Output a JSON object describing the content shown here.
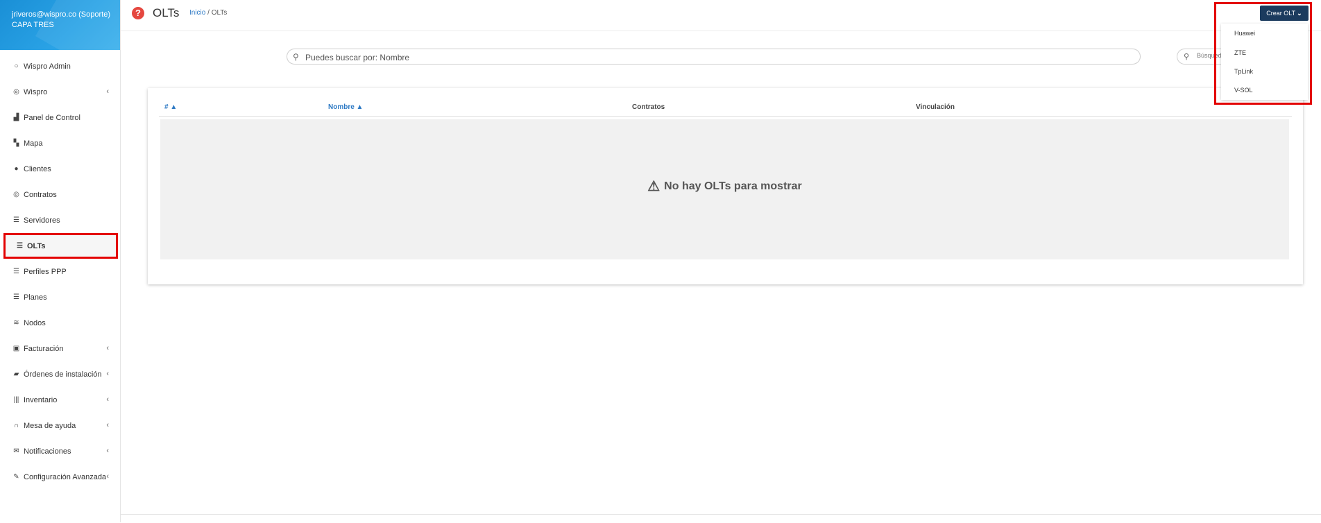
{
  "sidebar": {
    "user": {
      "email": "jriveros@wispro.co (Soporte)",
      "company": "CAPA TRES"
    },
    "items": [
      {
        "label": "Wispro Admin",
        "icon": "circle-notch-icon",
        "glyph": "○",
        "chevron": ""
      },
      {
        "label": "Wispro",
        "icon": "eye-icon",
        "glyph": "◎",
        "chevron": "‹"
      },
      {
        "label": "Panel de Control",
        "icon": "chart-area-icon",
        "glyph": "▟",
        "chevron": ""
      },
      {
        "label": "Mapa",
        "icon": "map-icon",
        "glyph": "▚",
        "chevron": ""
      },
      {
        "label": "Clientes",
        "icon": "users-icon",
        "glyph": "●",
        "chevron": ""
      },
      {
        "label": "Contratos",
        "icon": "handshake-icon",
        "glyph": "◎",
        "chevron": ""
      },
      {
        "label": "Servidores",
        "icon": "list-icon",
        "glyph": "☰",
        "chevron": ""
      },
      {
        "label": "OLTs",
        "icon": "list-icon",
        "glyph": "☰",
        "chevron": ""
      },
      {
        "label": "Perfiles PPP",
        "icon": "list-icon",
        "glyph": "☰",
        "chevron": ""
      },
      {
        "label": "Planes",
        "icon": "list-icon",
        "glyph": "☰",
        "chevron": ""
      },
      {
        "label": "Nodos",
        "icon": "wifi-icon",
        "glyph": "≋",
        "chevron": ""
      },
      {
        "label": "Facturación",
        "icon": "money-bill-icon",
        "glyph": "▣",
        "chevron": "‹"
      },
      {
        "label": "Órdenes de instalación",
        "icon": "truck-icon",
        "glyph": "▰",
        "chevron": "‹"
      },
      {
        "label": "Inventario",
        "icon": "barcode-icon",
        "glyph": "|||",
        "chevron": "‹"
      },
      {
        "label": "Mesa de ayuda",
        "icon": "headset-icon",
        "glyph": "∩",
        "chevron": "‹"
      },
      {
        "label": "Notificaciones",
        "icon": "envelope-icon",
        "glyph": "✉",
        "chevron": "‹"
      },
      {
        "label": "Configuración Avanzada",
        "icon": "wrench-icon",
        "glyph": "✎",
        "chevron": "‹"
      }
    ]
  },
  "header": {
    "title": "OLTs",
    "breadcrumb": {
      "home": "Inicio",
      "separator": "/",
      "current": "OLTs"
    },
    "help_glyph": "?"
  },
  "search": {
    "placeholder": "Puedes buscar por: Nombre",
    "value": "",
    "advanced_placeholder": "Búsqued"
  },
  "table": {
    "columns": [
      {
        "label": "# ▲",
        "sortable": true
      },
      {
        "label": "Nombre ▲",
        "sortable": true
      },
      {
        "label": "Contratos",
        "sortable": false
      },
      {
        "label": "Vinculación",
        "sortable": false
      }
    ],
    "empty_message": "No hay OLTs para mostrar"
  },
  "create_olt": {
    "label": "Crear OLT",
    "options": [
      "Huawei",
      "ZTE",
      "TpLink",
      "V-SOL"
    ]
  },
  "colors": {
    "accent": "#2d79c4",
    "button": "#1b3b5e",
    "highlight": "#e30000",
    "help": "#e5473f"
  }
}
